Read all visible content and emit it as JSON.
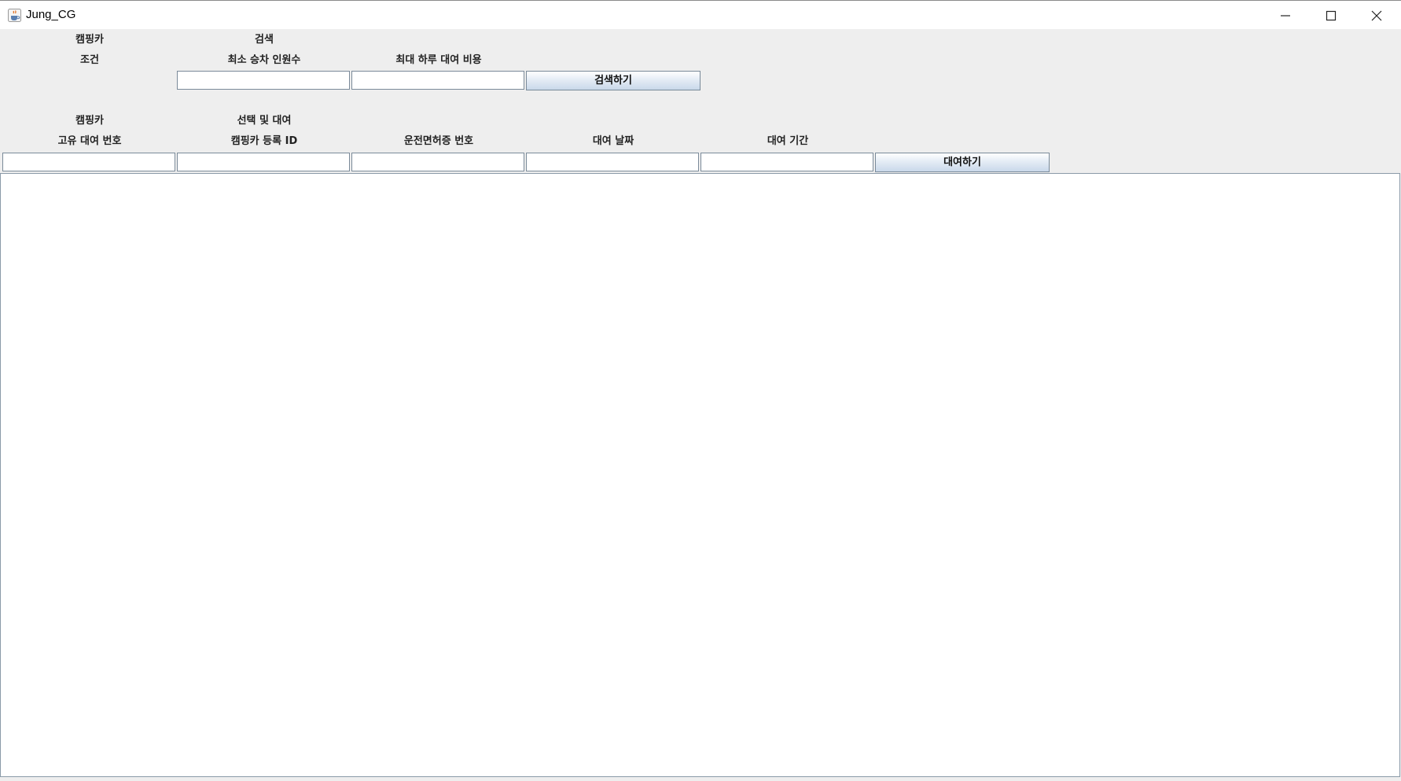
{
  "window": {
    "title": "Jung_CG",
    "icons": [
      "java-cup-icon",
      "minimize-icon",
      "maximize-icon",
      "close-icon"
    ]
  },
  "search_section": {
    "header_left": "캠핑카",
    "header_right": "검색",
    "row_label": "조건",
    "min_passengers_label": "최소 승차 인원수",
    "min_passengers_value": "",
    "max_daily_cost_label": "최대 하루 대여 비용",
    "max_daily_cost_value": "",
    "search_button": "검색하기"
  },
  "rental_section": {
    "header_left": "캠핑카",
    "header_right": "선택 및 대여",
    "rental_number_label": "고유 대여 번호",
    "rental_number_value": "",
    "camper_id_label": "캠핑카 등록 ID",
    "camper_id_value": "",
    "license_label": "운전면허증 번호",
    "license_value": "",
    "rental_date_label": "대여 날짜",
    "rental_date_value": "",
    "rental_period_label": "대여 기간",
    "rental_period_value": "",
    "rent_button": "대여하기"
  },
  "results": {
    "rows": []
  }
}
